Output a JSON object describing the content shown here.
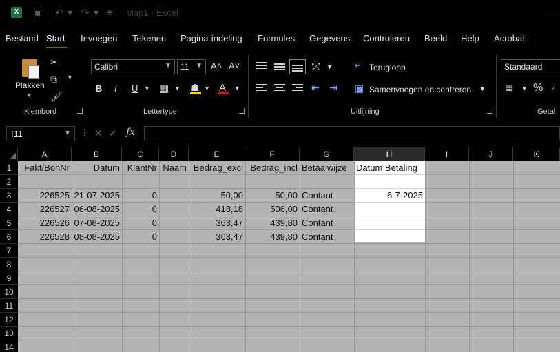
{
  "titlebar": {
    "title": "Map1 - Excel",
    "logo_letter": "X",
    "icons": [
      "save-icon",
      "undo-icon",
      "redo-icon",
      "customize-icon",
      "minimize-icon"
    ]
  },
  "tabs": [
    "Bestand",
    "Start",
    "Invoegen",
    "Tekenen",
    "Pagina-indeling",
    "Formules",
    "Gegevens",
    "Controleren",
    "Beeld",
    "Help",
    "Acrobat"
  ],
  "active_tab": "Start",
  "ribbon": {
    "clipboard": {
      "paste_label": "Plakken",
      "group_label": "Klembord"
    },
    "font": {
      "font_name": "Calibri",
      "font_size": "11",
      "bold": "B",
      "italic": "I",
      "underline": "U",
      "grow": "A˄",
      "shrink": "A˅",
      "font_color": "A",
      "group_label": "Lettertype"
    },
    "alignment": {
      "wrap_text": "Terugloop",
      "merge_center": "Samenvoegen en centreren",
      "group_label": "Uitlijning"
    },
    "number": {
      "format": "Standaard",
      "percent": "%",
      "group_label": "Getal"
    }
  },
  "formula_bar": {
    "name_box": "I11",
    "fx": "fx",
    "cancel": "✕",
    "enter": "✓",
    "value": ""
  },
  "columns": [
    "A",
    "B",
    "C",
    "D",
    "E",
    "F",
    "G",
    "H",
    "I",
    "J",
    "K"
  ],
  "rows": [
    "1",
    "2",
    "3",
    "4",
    "5",
    "6",
    "7",
    "8",
    "9",
    "10",
    "11",
    "12",
    "13",
    "14"
  ],
  "sheet": {
    "headers": [
      "Fakt/BonNr",
      "Datum",
      "KlantNr",
      "Naam",
      "Bedrag_excl",
      "Bedrag_incl",
      "Betaalwijze",
      "Datum Betaling"
    ],
    "data_rows": [
      {
        "row": "3",
        "cells": [
          "226525",
          "21-07-2025",
          "0",
          "",
          "50,00",
          "50,00",
          "Contant",
          "6-7-2025"
        ]
      },
      {
        "row": "4",
        "cells": [
          "226527",
          "06-08-2025",
          "0",
          "",
          "418,18",
          "506,00",
          "Contant",
          ""
        ]
      },
      {
        "row": "5",
        "cells": [
          "226526",
          "07-08-2025",
          "0",
          "",
          "363,47",
          "439,80",
          "Contant",
          ""
        ]
      },
      {
        "row": "6",
        "cells": [
          "226528",
          "08-08-2025",
          "0",
          "",
          "363,47",
          "439,80",
          "Contant",
          ""
        ]
      }
    ]
  },
  "colors": {
    "accent": "#1d8a4c",
    "grid_bg": "#b4b4b4",
    "highlight_col": "#ffffff",
    "underline_red": "#e81123",
    "highlight_yellow": "#ffd700"
  }
}
